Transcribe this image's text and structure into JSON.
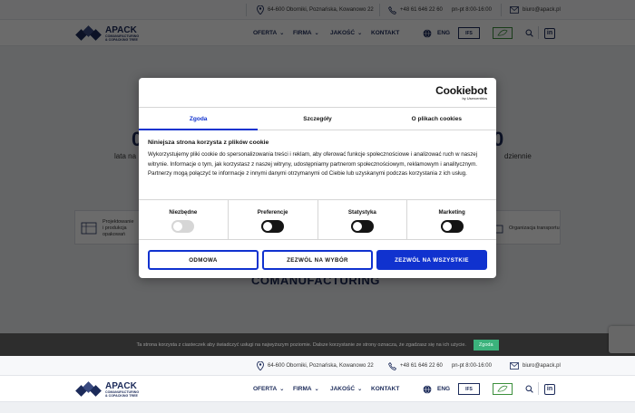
{
  "header": {
    "address": "64-600 Oborniki, Poznańska, Kowanowo 22",
    "phone": "+48 61 646 22 60",
    "hours": "pn-pt 8:00-16:00",
    "email": "biuro@apack.pl",
    "logo_name": "APACK",
    "logo_sub1": "COMANUFACTURING",
    "logo_sub2": "& COPACKING TREE",
    "menu": [
      {
        "label": "OFERTA",
        "has_dropdown": true
      },
      {
        "label": "FIRMA",
        "has_dropdown": true
      },
      {
        "label": "JAKOŚĆ",
        "has_dropdown": true
      },
      {
        "label": "KONTAKT",
        "has_dropdown": false
      }
    ],
    "language": "ENG",
    "cert_label": "IFS"
  },
  "hero": {
    "left_big": "0",
    "right_big": "0",
    "left_line": "lata na",
    "right_line": "dziennie",
    "services": [
      {
        "label_1": "Projektowanie",
        "label_2": "i produkcja",
        "label_3": "opakowań"
      },
      {
        "label_1": "Organizacja transportu",
        "label_2": "",
        "label_3": ""
      }
    ],
    "section_title": "COMANUFACTURING"
  },
  "cookie_modal": {
    "brand": "Cookiebot",
    "brand_sub": "by Usercentrics",
    "tabs": [
      {
        "label": "Zgoda",
        "active": true
      },
      {
        "label": "Szczegóły",
        "active": false
      },
      {
        "label": "O plikach cookies",
        "active": false
      }
    ],
    "heading": "Niniejsza strona korzysta z plików cookie",
    "text": "Wykorzystujemy pliki cookie do spersonalizowania treści i reklam, aby oferować funkcje społecznościowe i analizować ruch w naszej witrynie. Informacje o tym, jak korzystasz z naszej witryny, udostępniamy partnerom społecznościowym, reklamowym i analitycznym. Partnerzy mogą połączyć te informacje z innymi danymi otrzymanymi od Ciebie lub uzyskanymi podczas korzystania z ich usług.",
    "toggles": [
      {
        "label": "Niezbędne",
        "state": "off",
        "disabled": true
      },
      {
        "label": "Preferencje",
        "state": "off",
        "disabled": false
      },
      {
        "label": "Statystyka",
        "state": "off",
        "disabled": false
      },
      {
        "label": "Marketing",
        "state": "off",
        "disabled": false
      }
    ],
    "buttons": {
      "deny": "ODMOWA",
      "allow_selection": "ZEZWÓL NA WYBÓR",
      "allow_all": "ZEZWÓL NA WSZYSTKIE"
    }
  },
  "notice_bar": {
    "text": "Ta strona korzysta z ciasteczek aby świadczyć usługi na najwyższym poziomie. Dalsze korzystanie ze strony oznacza, że zgadzasz się na ich użycie.",
    "ok_label": "Zgoda"
  },
  "colors": {
    "navy": "#1c2b5a",
    "cookie_blue": "#1032cf",
    "notice_bg": "#2d2d2d",
    "notice_ok": "#3bb27c"
  }
}
